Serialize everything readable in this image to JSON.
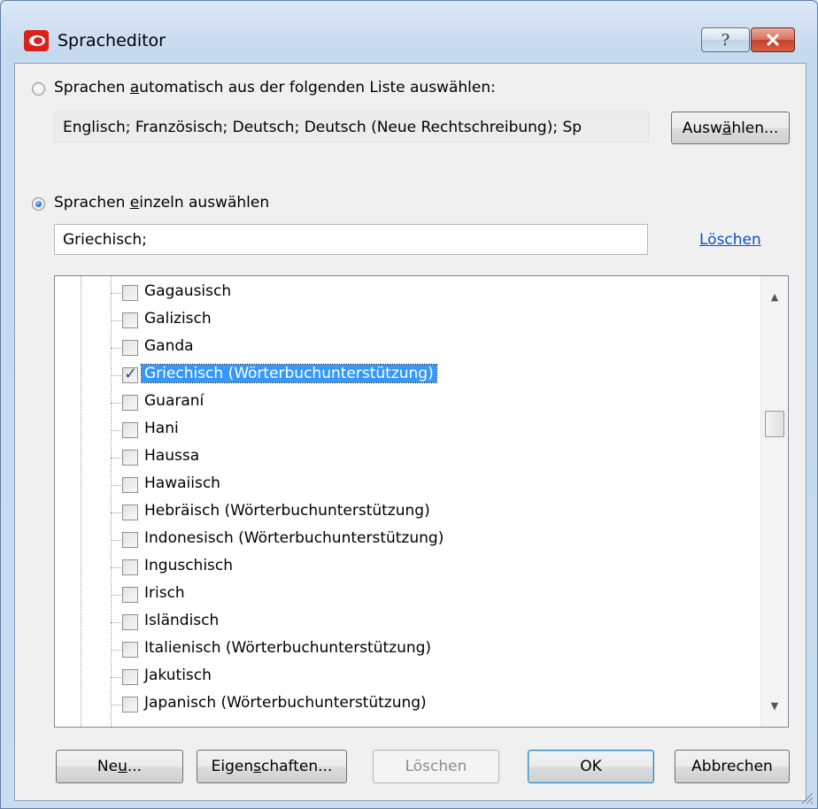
{
  "window": {
    "title": "Spracheditor",
    "help_label": "?",
    "close_label": "✕"
  },
  "auto_option": {
    "label_pre": "Sprachen ",
    "label_accel": "a",
    "label_post": "utomatisch aus der folgenden Liste auswählen:",
    "selected": false,
    "languages_value": "Englisch; Französisch; Deutsch; Deutsch (Neue Rechtschreibung); Sp",
    "choose_button_pre": "Ausw",
    "choose_button_accel": "ä",
    "choose_button_post": "hlen..."
  },
  "manual_option": {
    "label_pre": "Sprachen ",
    "label_accel": "e",
    "label_post": "inzeln auswählen",
    "selected": true,
    "value": "Griechisch;",
    "clear_link": "Löschen"
  },
  "languages": [
    {
      "label": "Gagausisch",
      "checked": false
    },
    {
      "label": "Galizisch",
      "checked": false
    },
    {
      "label": "Ganda",
      "checked": false
    },
    {
      "label": "Griechisch (Wörterbuchunterstützung)",
      "checked": true,
      "selected": true
    },
    {
      "label": "Guaraní",
      "checked": false
    },
    {
      "label": "Hani",
      "checked": false
    },
    {
      "label": "Haussa",
      "checked": false
    },
    {
      "label": "Hawaiisch",
      "checked": false
    },
    {
      "label": "Hebräisch (Wörterbuchunterstützung)",
      "checked": false
    },
    {
      "label": "Indonesisch (Wörterbuchunterstützung)",
      "checked": false
    },
    {
      "label": "Inguschisch",
      "checked": false
    },
    {
      "label": "Irisch",
      "checked": false
    },
    {
      "label": "Isländisch",
      "checked": false
    },
    {
      "label": "Italienisch (Wörterbuchunterstützung)",
      "checked": false
    },
    {
      "label": "Jakutisch",
      "checked": false
    },
    {
      "label": "Japanisch (Wörterbuchunterstützung)",
      "checked": false
    }
  ],
  "buttons": {
    "new_pre": "Ne",
    "new_accel": "u",
    "new_post": "...",
    "properties_pre": "Eigen",
    "properties_accel": "s",
    "properties_post": "chaften...",
    "delete": "Löschen",
    "ok": "OK",
    "cancel": "Abbrechen"
  },
  "colors": {
    "selection": "#3399ff",
    "link": "#0b53c3",
    "app_icon": "#d8231c"
  }
}
